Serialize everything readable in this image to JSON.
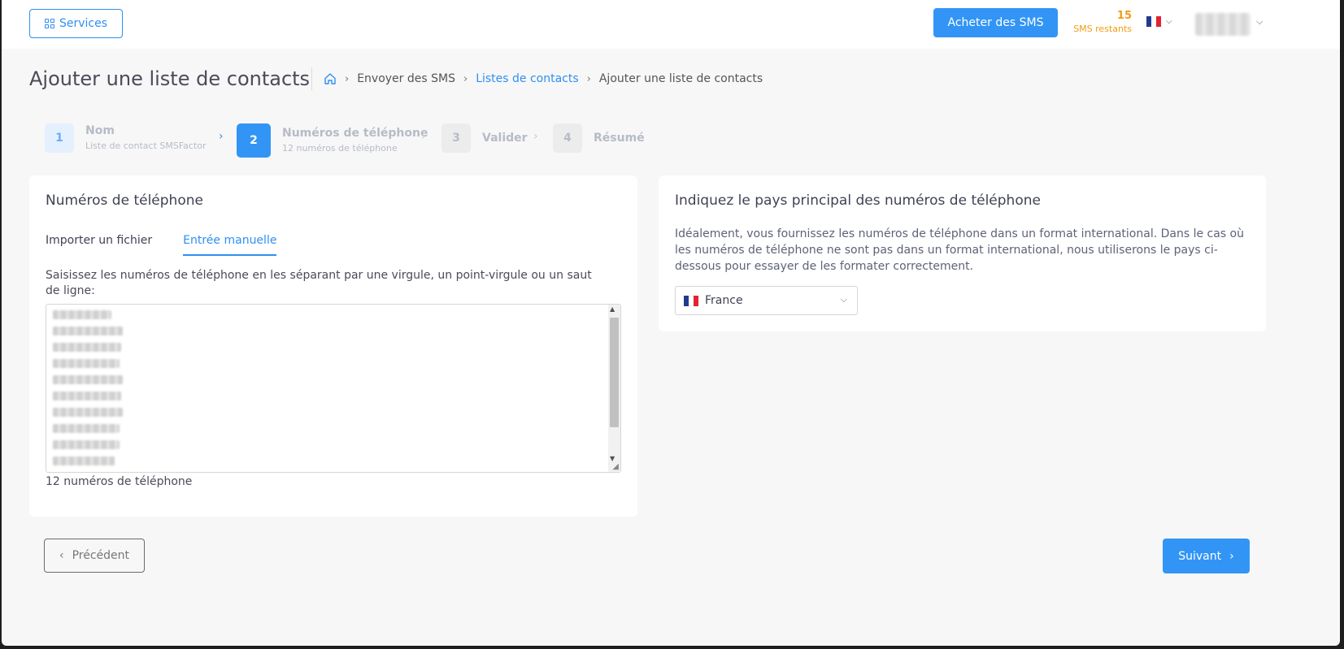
{
  "topbar": {
    "services_label": "Services",
    "buy_label": "Acheter des SMS",
    "sms_count": "15",
    "sms_label": "SMS restants"
  },
  "page": {
    "title": "Ajouter une liste de contacts"
  },
  "breadcrumb": {
    "items": [
      "Envoyer des SMS",
      "Listes de contacts",
      "Ajouter une liste de contacts"
    ]
  },
  "stepper": {
    "steps": [
      {
        "num": "1",
        "title": "Nom",
        "subtitle": "Liste de contact SMSFactor",
        "state": "done"
      },
      {
        "num": "2",
        "title": "Numéros de téléphone",
        "subtitle": "12 numéros de téléphone",
        "state": "active"
      },
      {
        "num": "3",
        "title": "Valider",
        "subtitle": "",
        "state": "pending"
      },
      {
        "num": "4",
        "title": "Résumé",
        "subtitle": "",
        "state": "pending"
      }
    ]
  },
  "phones_card": {
    "title": "Numéros de téléphone",
    "tabs": [
      "Importer un fichier",
      "Entrée manuelle"
    ],
    "active_tab": 1,
    "help": "Saisissez les numéros de téléphone en les séparant par une virgule, un point-virgule ou un saut de ligne:",
    "count_text": "12 numéros de téléphone"
  },
  "country_card": {
    "title": "Indiquez le pays principal des numéros de téléphone",
    "description": "Idéalement, vous fournissez les numéros de téléphone dans un format international. Dans le cas où les numéros de téléphone ne sont pas dans un format international, nous utiliserons le pays ci-dessous pour essayer de les formater correctement.",
    "selected_country": "France"
  },
  "footer": {
    "prev_label": "Précédent",
    "next_label": "Suivant"
  },
  "colors": {
    "accent": "#3295f5",
    "credits": "#f39c12",
    "flag_blue": "#1f3c8c",
    "flag_red": "#e1242f"
  },
  "icons": {
    "services": "grid-icon",
    "home": "home-icon",
    "breadcrumb_sep": "chevron-right-icon",
    "lang": "flag-fr-icon"
  }
}
